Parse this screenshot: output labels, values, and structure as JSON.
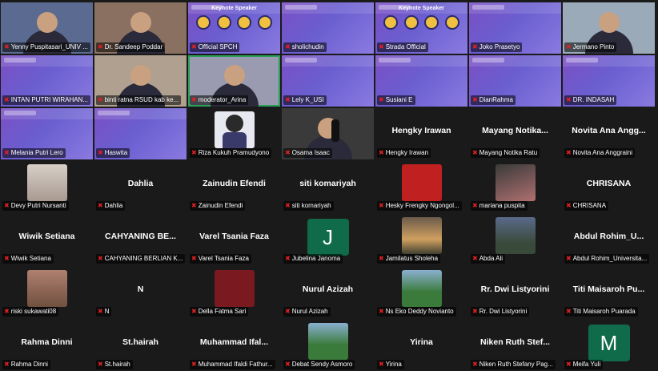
{
  "colors": {
    "background": "#1a1a1a",
    "banner": "#7b4fc4",
    "muted_mic": "#e02020",
    "active_speaker": "#2aa05a"
  },
  "muted_icon": "muted-microphone-icon",
  "rows": [
    [
      {
        "name": "Yenny Puspitasari_UNIV ...",
        "kind": "video",
        "variant": "woman"
      },
      {
        "name": "Dr. Sandeep Poddar",
        "kind": "video",
        "variant": "man-orange"
      },
      {
        "name": "Official SPCH",
        "kind": "poster"
      },
      {
        "name": "sholichudin",
        "kind": "banner"
      },
      {
        "name": "Strada Official",
        "kind": "poster"
      },
      {
        "name": "Joko Prasetyo",
        "kind": "banner"
      },
      {
        "name": "Jermano Pinto",
        "kind": "video",
        "variant": "man-light"
      }
    ],
    [
      {
        "name": "INTAN PUTRI WIRAHAN...",
        "kind": "banner"
      },
      {
        "name": "binti ratna RSUD kab ke...",
        "kind": "video",
        "variant": "chair"
      },
      {
        "name": "moderator_Arina",
        "kind": "video",
        "variant": "glasses",
        "highlight": true
      },
      {
        "name": "Lely K_USI",
        "kind": "banner"
      },
      {
        "name": "Susiani E",
        "kind": "banner"
      },
      {
        "name": "DianRahma",
        "kind": "banner"
      },
      {
        "name": "DR. INDASAH",
        "kind": "banner"
      }
    ],
    [
      {
        "name": "Melania Putri Lero",
        "kind": "banner"
      },
      {
        "name": "Haswita",
        "kind": "banner"
      },
      {
        "name": "Riza Kukuh Pramudyono",
        "kind": "pic",
        "pic": "cartoon"
      },
      {
        "name": "Osama Isaac",
        "kind": "video",
        "variant": "studio"
      },
      {
        "name": "Hengky Irawan",
        "kind": "blank",
        "title": "Hengky Irawan"
      },
      {
        "name": "Mayang Notika Ratu",
        "kind": "blank",
        "title": "Mayang  Notika..."
      },
      {
        "name": "Novita Ana Anggraini",
        "kind": "blank",
        "title": "Novita Ana Angg..."
      }
    ],
    [
      {
        "name": "Devy Putri Nursanti",
        "kind": "pic",
        "pic": "hijab"
      },
      {
        "name": "Dahlia",
        "kind": "blank",
        "title": "Dahlia"
      },
      {
        "name": "Zainudin Efendi",
        "kind": "blank",
        "title": "Zainudin Efendi"
      },
      {
        "name": "siti komariyah",
        "kind": "blank",
        "title": "siti komariyah"
      },
      {
        "name": "Hesky Frengky Ngongol...",
        "kind": "pic",
        "pic": "red"
      },
      {
        "name": "mariana puspita",
        "kind": "pic",
        "pic": "family"
      },
      {
        "name": "CHRISANA",
        "kind": "blank",
        "title": "CHRISANA"
      }
    ],
    [
      {
        "name": "Wiwik Setiana",
        "kind": "blank",
        "title": "Wiwik Setiana"
      },
      {
        "name": "CAHYANING BERLIAN K...",
        "kind": "blank",
        "title": "CAHYANING  BE..."
      },
      {
        "name": "Varel Tsania Faza",
        "kind": "blank",
        "title": "Varel Tsania Faza"
      },
      {
        "name": "Jubelina Janoma",
        "kind": "letter",
        "letter": "J",
        "color": "#0f6b4a"
      },
      {
        "name": "Jamilatus Sholeha",
        "kind": "pic",
        "pic": "sunset"
      },
      {
        "name": "Abda Ali",
        "kind": "pic",
        "pic": "mountain"
      },
      {
        "name": "Abdul Rohim_Universita...",
        "kind": "blank",
        "title": "Abdul  Rohim_U..."
      }
    ],
    [
      {
        "name": "riski sukawati08",
        "kind": "pic",
        "pic": "room"
      },
      {
        "name": "N",
        "kind": "blank",
        "title": "N"
      },
      {
        "name": "Della Fatma Sari",
        "kind": "pic",
        "pic": "dred"
      },
      {
        "name": "Nurul Azizah",
        "kind": "blank",
        "title": "Nurul Azizah"
      },
      {
        "name": "Ns Eko Deddy Novianto",
        "kind": "pic",
        "pic": "outdoor"
      },
      {
        "name": "Rr. Dwi Listyorini",
        "kind": "blank",
        "title": "Rr. Dwi Listyorini"
      },
      {
        "name": "Titi Maisaroh Puarada",
        "kind": "blank",
        "title": "Titi  Maisaroh  Pu..."
      }
    ],
    [
      {
        "name": "Rahma Dinni",
        "kind": "blank",
        "title": "Rahma Dinni"
      },
      {
        "name": "St.hairah",
        "kind": "blank",
        "title": "St.hairah"
      },
      {
        "name": "Muhammad Ifaldi Fathur...",
        "kind": "blank",
        "title": "Muhammad  Ifal..."
      },
      {
        "name": "Debat Sendy Asmoro",
        "kind": "pic",
        "pic": "outdoor"
      },
      {
        "name": "Yirina",
        "kind": "blank",
        "title": "Yirina"
      },
      {
        "name": "Niken Ruth Stefany Pag...",
        "kind": "blank",
        "title": "Niken  Ruth  Stef..."
      },
      {
        "name": "Meifa Yuli",
        "kind": "letter",
        "letter": "M",
        "color": "#0f6b4a"
      }
    ]
  ],
  "poster_text": "Keynote Speaker"
}
